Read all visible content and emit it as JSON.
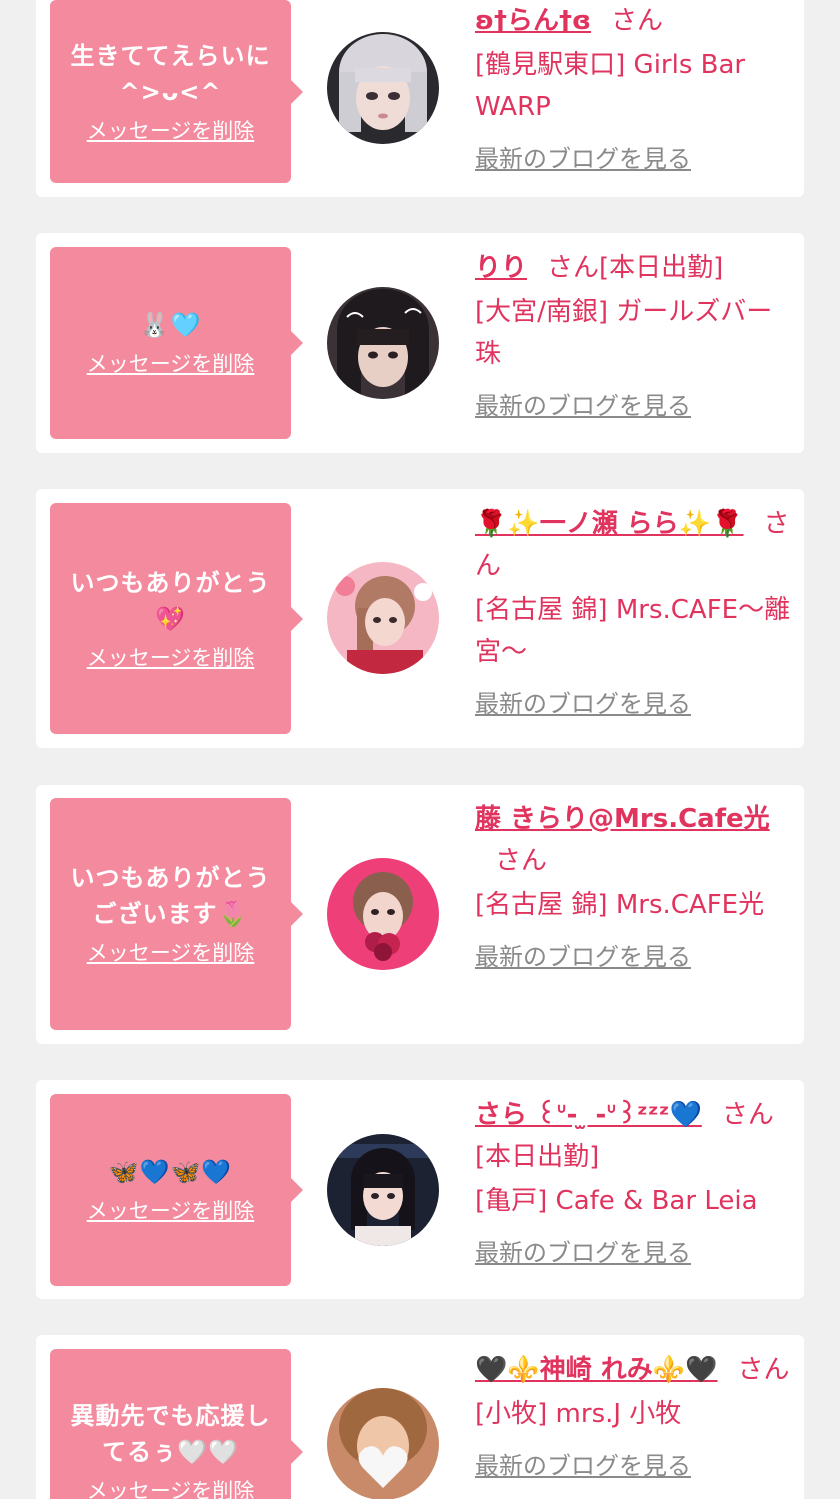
{
  "colors": {
    "page_background": "#f0f0f0",
    "card_background": "#ffffff",
    "bubble": "#f48a9d",
    "accent_text": "#e0345f",
    "muted_link": "#8a8a8a"
  },
  "messages": [
    {
      "message": "生きててえらいに\n^>ᴗ<^",
      "delete_label": "メッセージを削除",
      "cast_name": "ʚ†らん†ɞ",
      "honorific": "さん",
      "status": "",
      "shop": "[鶴見駅東口] Girls Bar WARP",
      "blog_label": "最新のブログを見る",
      "avatar_icon": "avatar-photo-silver-hair"
    },
    {
      "message": "🐰🩵",
      "delete_label": "メッセージを削除",
      "cast_name": "りり",
      "honorific": "さん",
      "status": "[本日出勤]",
      "shop": "[大宮/南銀] ガールズバー 珠",
      "blog_label": "最新のブログを見る",
      "avatar_icon": "avatar-photo-dark-hair"
    },
    {
      "message": "いつもありがとう\n💖",
      "delete_label": "メッセージを削除",
      "cast_name": "🌹✨一ノ瀬 らら✨🌹",
      "honorific": "さん",
      "status": "",
      "shop": "[名古屋 錦] Mrs.CAFE〜離宮〜",
      "blog_label": "最新のブログを見る",
      "avatar_icon": "avatar-photo-pink-room"
    },
    {
      "message": "いつもありがとう\nございます🌷",
      "delete_label": "メッセージを削除",
      "cast_name": "藤 きらり@Mrs.Cafe光",
      "honorific": "さん",
      "status": "",
      "shop": "[名古屋 錦] Mrs.CAFE光",
      "blog_label": "最新のブログを見る",
      "avatar_icon": "avatar-photo-pink-background"
    },
    {
      "message": "🦋💙🦋💙",
      "delete_label": "メッセージを削除",
      "cast_name": "さら ꒰ᐡ- ̫ -ᐡ꒱ᶻᶻᶻ💙",
      "honorific": "さん",
      "status": "[本日出勤]",
      "shop": "[亀戸] Cafe & Bar Leia",
      "blog_label": "最新のブログを見る",
      "avatar_icon": "avatar-photo-bangs"
    },
    {
      "message": "異動先でも応援し\nてるぅ🤍🤍",
      "delete_label": "メッセージを削除",
      "cast_name": "🖤⚜️神崎 れみ⚜️🖤",
      "honorific": "さん",
      "status": "",
      "shop": "[小牧] mrs.J 小牧",
      "blog_label": "最新のブログを見る",
      "avatar_icon": "avatar-photo-heart-covered"
    }
  ]
}
